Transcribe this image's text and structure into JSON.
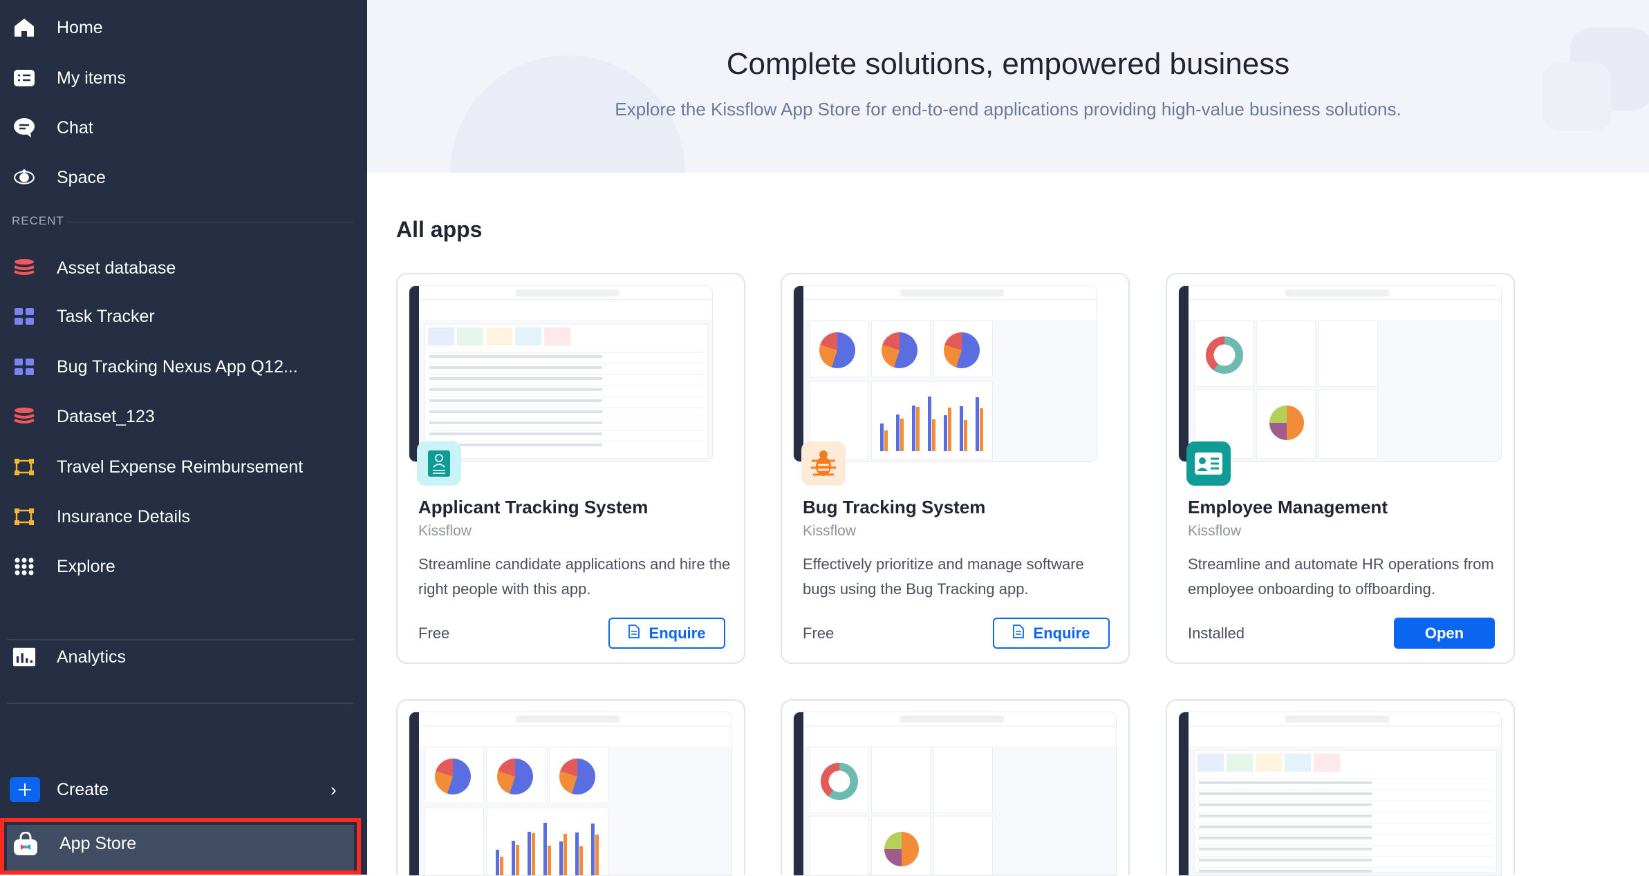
{
  "sidebar": {
    "nav": [
      {
        "label": "Home",
        "icon": "home-icon"
      },
      {
        "label": "My items",
        "icon": "checklist-icon"
      },
      {
        "label": "Chat",
        "icon": "chat-icon"
      },
      {
        "label": "Space",
        "icon": "space-icon"
      }
    ],
    "recent_label": "RECENT",
    "recent": [
      {
        "label": "Asset database",
        "icon": "database-icon",
        "color": "#f0585a"
      },
      {
        "label": "Task Tracker",
        "icon": "board-icon",
        "color": "#7c83f2"
      },
      {
        "label": "Bug Tracking Nexus App Q12...",
        "icon": "board-icon",
        "color": "#7c83f2"
      },
      {
        "label": "Dataset_123",
        "icon": "database-icon",
        "color": "#f0585a"
      },
      {
        "label": "Travel Expense Reimbursement",
        "icon": "process-icon",
        "color": "#f5b731"
      },
      {
        "label": "Insurance Details",
        "icon": "process-icon",
        "color": "#f5b731"
      },
      {
        "label": "Explore",
        "icon": "grid-dots-icon",
        "color": "#ffffff"
      }
    ],
    "analytics": "Analytics",
    "create": "Create",
    "app_store": "App Store"
  },
  "hero": {
    "title": "Complete solutions, empowered business",
    "subtitle": "Explore the Kissflow App Store for end-to-end applications providing high-value business solutions."
  },
  "section_title": "All apps",
  "apps": [
    {
      "title": "Applicant Tracking System",
      "vendor": "Kissflow",
      "desc": "Streamline candidate applications and hire the right people with this app.",
      "price": "Free",
      "action": "Enquire",
      "icon_bg": "#c9f3f4",
      "icon_fg": "#129a96"
    },
    {
      "title": "Bug Tracking System",
      "vendor": "Kissflow",
      "desc": "Effectively prioritize and manage software bugs using the Bug Tracking app.",
      "price": "Free",
      "action": "Enquire",
      "icon_bg": "#fdebd8",
      "icon_fg": "#f47c20"
    },
    {
      "title": "Employee Management",
      "vendor": "Kissflow",
      "desc": "Streamline and automate HR operations from employee onboarding to offboarding.",
      "price": "Installed",
      "action": "Open",
      "icon_bg": "#0f9b96",
      "icon_fg": "#ffffff"
    }
  ],
  "colors": {
    "sidebar_bg": "#252e42",
    "accent": "#0a65f0",
    "highlight": "#ff2a1f"
  }
}
